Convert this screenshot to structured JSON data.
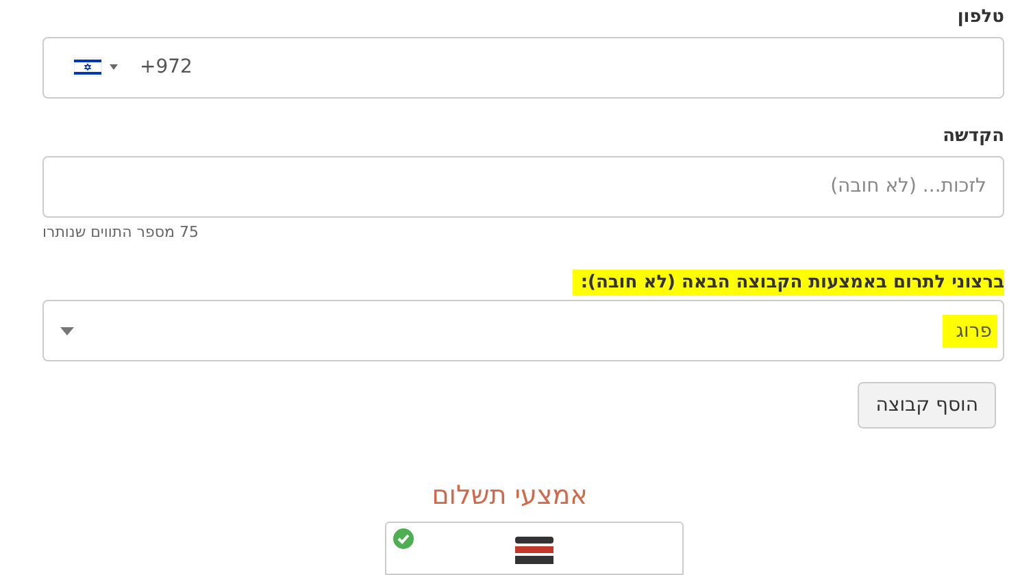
{
  "phone": {
    "label": "טלפון",
    "country_selected": true,
    "code": "+972"
  },
  "dedication": {
    "label": "הקדשה",
    "placeholder": "לזכות... (לא חובה)",
    "helper": "75 מספר התווים שנותרו"
  },
  "group": {
    "label": "ברצוני לתרום באמצעות הקבוצה הבאה (לא חובה):",
    "label_highlighted": true,
    "value": "פרוג",
    "value_highlighted": true
  },
  "add_group_button": "הוסף קבוצה",
  "payment": {
    "heading": "אמצעי תשלום",
    "methods": [
      {
        "kind": "picture",
        "selected": true
      }
    ]
  }
}
